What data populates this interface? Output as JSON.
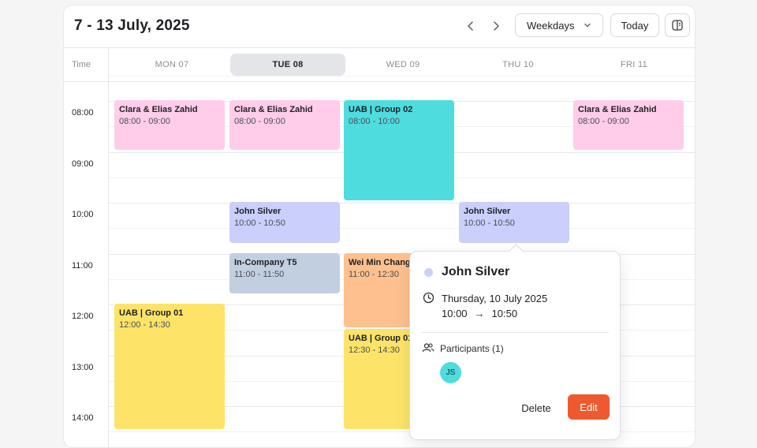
{
  "colors": {
    "pink": "#ffcdea",
    "teal": "#4fdcdf",
    "lavender": "#cacffb",
    "slate": "#c2cfe0",
    "peach": "#ffc08f",
    "yellow": "#fde468",
    "accent": "#ee5a2f"
  },
  "header": {
    "title": "7 - 13 July, 2025",
    "prev_icon": "chevron-left-icon",
    "next_icon": "chevron-right-icon",
    "view": "Weekdays",
    "today_label": "Today",
    "panel_icon": "sidebar-panel-icon"
  },
  "columns": {
    "time_label": "Time",
    "days": [
      "MON 07",
      "TUE 08",
      "WED 09",
      "THU 10",
      "FRI 11"
    ],
    "active_day": "TUE 08"
  },
  "hours": [
    "08:00",
    "09:00",
    "10:00",
    "11:00",
    "12:00",
    "13:00",
    "14:00"
  ],
  "events": [
    {
      "title": "Clara & Elias Zahid",
      "time": "08:00 - 09:00",
      "day": 0,
      "color": "pink"
    },
    {
      "title": "Clara & Elias Zahid",
      "time": "08:00 - 09:00",
      "day": 1,
      "color": "pink"
    },
    {
      "title": "UAB | Group 02",
      "time": "08:00 - 10:00",
      "day": 2,
      "color": "teal"
    },
    {
      "title": "Clara & Elias Zahid",
      "time": "08:00 - 09:00",
      "day": 4,
      "color": "pink"
    },
    {
      "title": "John Silver",
      "time": "10:00 - 10:50",
      "day": 1,
      "color": "lavender"
    },
    {
      "title": "John Silver",
      "time": "10:00 - 10:50",
      "day": 3,
      "color": "lavender"
    },
    {
      "title": "In-Company T5",
      "time": "11:00 - 11:50",
      "day": 1,
      "color": "slate"
    },
    {
      "title": "Wei Min Chang",
      "time": "11:00 - 12:30",
      "day": 2,
      "color": "peach"
    },
    {
      "title": "UAB | Group 01",
      "time": "12:00 - 14:30",
      "day": 0,
      "color": "yellow"
    },
    {
      "title": "UAB | Group 01",
      "time": "12:30 - 14:30",
      "day": 2,
      "color": "yellow"
    }
  ],
  "popover": {
    "title": "John Silver",
    "date": "Thursday, 10 July 2025",
    "start": "10:00",
    "arrow": "→",
    "end": "10:50",
    "participants_label": "Participants (1)",
    "avatar_initials": "JS",
    "avatar_color": "#4fdcdf",
    "delete_label": "Delete",
    "edit_label": "Edit"
  }
}
